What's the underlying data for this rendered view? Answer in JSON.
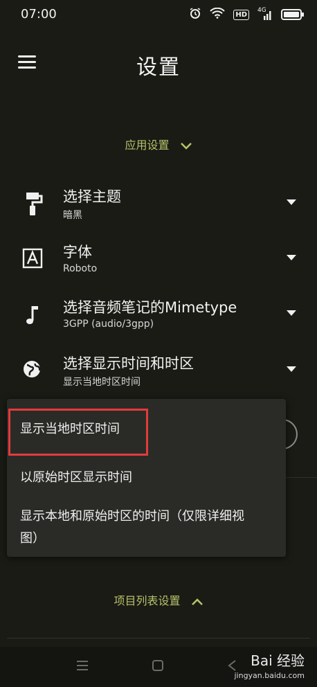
{
  "status_bar": {
    "time": "07:00",
    "hd_label": "HD",
    "signal_label": "4G"
  },
  "header": {
    "title": "设置"
  },
  "app_settings": {
    "header": "应用设置",
    "items": [
      {
        "title": "选择主题",
        "subtitle": "暗黑",
        "icon": "paint-roller-icon"
      },
      {
        "title": "字体",
        "subtitle": "Roboto",
        "icon": "font-icon"
      },
      {
        "title": "选择音频笔记的Mimetype",
        "subtitle": "3GPP (audio/3gpp)",
        "icon": "music-note-icon"
      },
      {
        "title": "选择显示时间和时区",
        "subtitle": "显示当地时区时间",
        "icon": "globe-icon"
      }
    ]
  },
  "timezone_dropdown": {
    "options": [
      "显示当地时区时间",
      "以原始时区显示时间",
      "显示本地和原始时区的时间（仅限详细视",
      "图）"
    ]
  },
  "list_settings": {
    "header": "项目列表设置"
  },
  "watermark": {
    "brand": "Bai 经验",
    "url": "jingyan.baidu.com"
  },
  "colors": {
    "accent": "#b7c26a",
    "highlight": "#e23b3b",
    "background": "#1a1b15"
  }
}
